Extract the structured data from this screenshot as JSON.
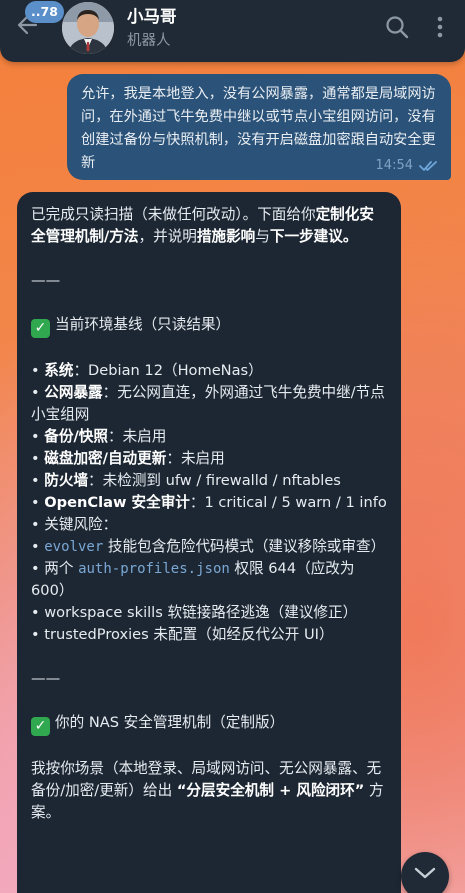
{
  "header": {
    "unread_count": "..78",
    "contact_name": "小马哥",
    "contact_status": "机器人"
  },
  "outgoing": {
    "text": "允许，我是本地登入，没有公网暴露，通常都是局域网访问，在外通过飞牛免费中继以或节点小宝组网访问，没有创建过备份与快照机制，没有开启磁盘加密跟自动安全更新",
    "time": "14:54"
  },
  "incoming": {
    "intro_1": "已完成只读扫描（未做任何改动）。下面给你",
    "intro_b1": "定制化安全管理机制/方法",
    "intro_2": "，并说明",
    "intro_b2": "措施影响",
    "intro_3": "与",
    "intro_b3": "下一步建议。",
    "divider": "——",
    "section1_title": "当前环境基线（只读结果）",
    "baseline": [
      {
        "label": "系统",
        "value": "：Debian 12（HomeNas）"
      },
      {
        "label": "公网暴露",
        "value": "：无公网直连，外网通过飞牛免费中继/节点小宝组网"
      },
      {
        "label": "备份/快照",
        "value": "：未启用"
      },
      {
        "label": "磁盘加密/自动更新",
        "value": "：未启用"
      },
      {
        "label": "防火墙",
        "value": "：未检测到 ufw / firewalld / nftables"
      },
      {
        "label": "OpenClaw 安全审计",
        "value": "：1 critical / 5 warn / 1 info"
      }
    ],
    "risks_title": "• 关键风险：",
    "risk1_code": "evolver",
    "risk1_text": " 技能包含危险代码模式（建议移除或审查）",
    "risk2_pre": "• 两个 ",
    "risk2_code": "auth-profiles.json",
    "risk2_text": " 权限 644（应改为 600）",
    "risk3": "• workspace skills 软链接路径逃逸（建议修正）",
    "risk4": "• trustedProxies 未配置（如经反代公开 UI）",
    "section2_title": "你的 NAS 安全管理机制（定制版）",
    "closing_1": "我按你场景（本地登录、局域网访问、无公网暴露、无备份/加密/更新）给出 ",
    "closing_b": "“分层安全机制 + 风险闭环”",
    "closing_2": " 方案。",
    "check_icon": "✓"
  },
  "icons": {
    "back": "back-arrow-icon",
    "search": "search-icon",
    "menu": "more-vertical-icon",
    "read": "double-check-icon",
    "scroll": "chevron-down-icon"
  },
  "colors": {
    "header_bg": "#1f2a36",
    "outgoing_bg": "#2b5278",
    "incoming_bg": "#1d2733",
    "badge": "#5b8fc9",
    "code": "#7aa7d4",
    "check": "#2fa84f"
  }
}
